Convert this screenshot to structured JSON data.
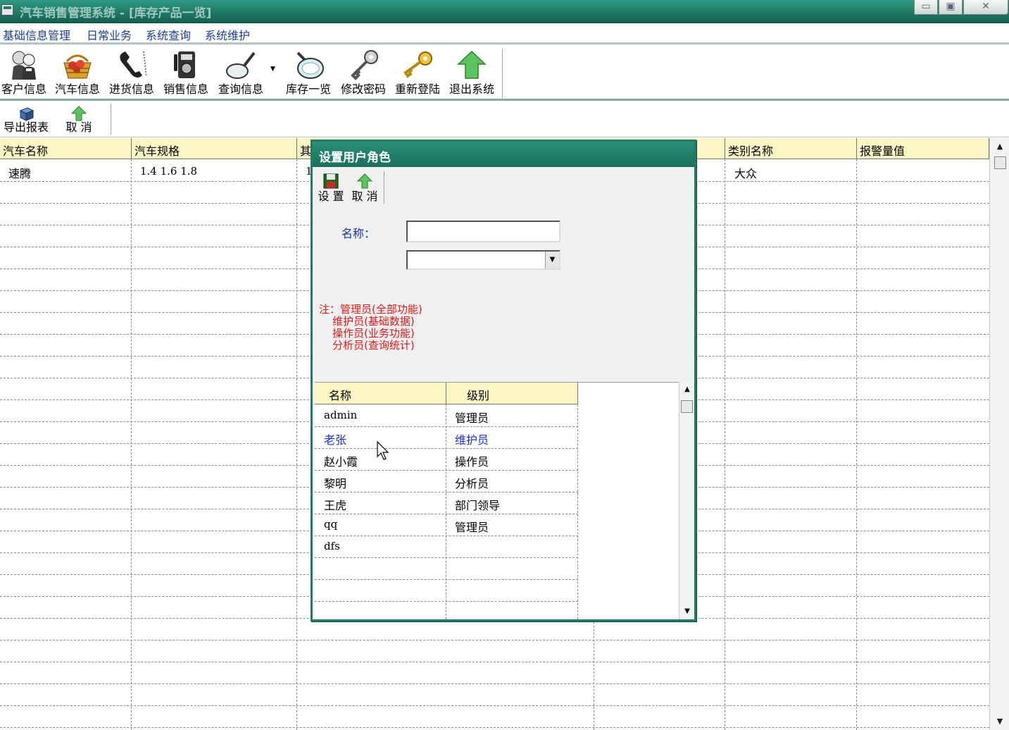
{
  "window": {
    "title": "汽车销售管理系统 - [库存产品一览]",
    "min_glyph": "▭",
    "max_glyph": "▣",
    "close_glyph": "✕"
  },
  "menu": [
    "基础信息管理",
    "日常业务",
    "系统查询",
    "系统维护"
  ],
  "toolbar": [
    {
      "label": "客户信息",
      "icon": "customer-icon"
    },
    {
      "label": "汽车信息",
      "icon": "car-basket-icon"
    },
    {
      "label": "进货信息",
      "icon": "phone-handset-icon"
    },
    {
      "label": "销售信息",
      "icon": "payphone-icon"
    },
    {
      "label": "查询信息",
      "icon": "magnifier-icon"
    },
    {
      "label": "库存一览",
      "icon": "magnifier-glass-icon"
    },
    {
      "label": "修改密码",
      "icon": "silver-key-icon"
    },
    {
      "label": "重新登陆",
      "icon": "gold-key-icon"
    },
    {
      "label": "退出系统",
      "icon": "up-arrow-icon"
    }
  ],
  "toolbar2": [
    {
      "label": "导出报表",
      "icon": "export-icon"
    },
    {
      "label": "取 消",
      "icon": "up-arrow-icon"
    }
  ],
  "grid": {
    "columns": [
      "汽车名称",
      "汽车规格",
      "其",
      "类别名称",
      "报警量值"
    ],
    "rows": [
      {
        "name": "速腾",
        "spec": "1.4 1.6 1.8",
        "other": "1",
        "category": "大众",
        "alarm": ""
      }
    ]
  },
  "dialog": {
    "title": "设置用户角色",
    "toolbar": [
      {
        "label": "设 置",
        "icon": "save-disk-icon"
      },
      {
        "label": "取 消",
        "icon": "up-arrow-icon"
      }
    ],
    "name_label": "名称：",
    "name_value": "",
    "role_value": "",
    "note_lines": [
      "注：管理员(全部功能)",
      "    维护员(基础数据)",
      "    操作员(业务功能)",
      "    分析员(查询统计)"
    ],
    "table": {
      "columns": [
        "名称",
        "级别"
      ],
      "rows": [
        {
          "name": "admin",
          "level": "管理员"
        },
        {
          "name": "老张",
          "level": "维护员"
        },
        {
          "name": "赵小霞",
          "level": "操作员"
        },
        {
          "name": "黎明",
          "level": "分析员"
        },
        {
          "name": "王虎",
          "level": "部门领导"
        },
        {
          "name": "qq",
          "level": "管理员"
        },
        {
          "name": "dfs",
          "level": ""
        }
      ],
      "highlight_color": "#1a2fd0"
    }
  },
  "colors": {
    "titlebar": "#1f7a66",
    "header_bg": "#fbf6c4",
    "menu_text": "#1a3d9a",
    "note_text": "#e01818"
  }
}
